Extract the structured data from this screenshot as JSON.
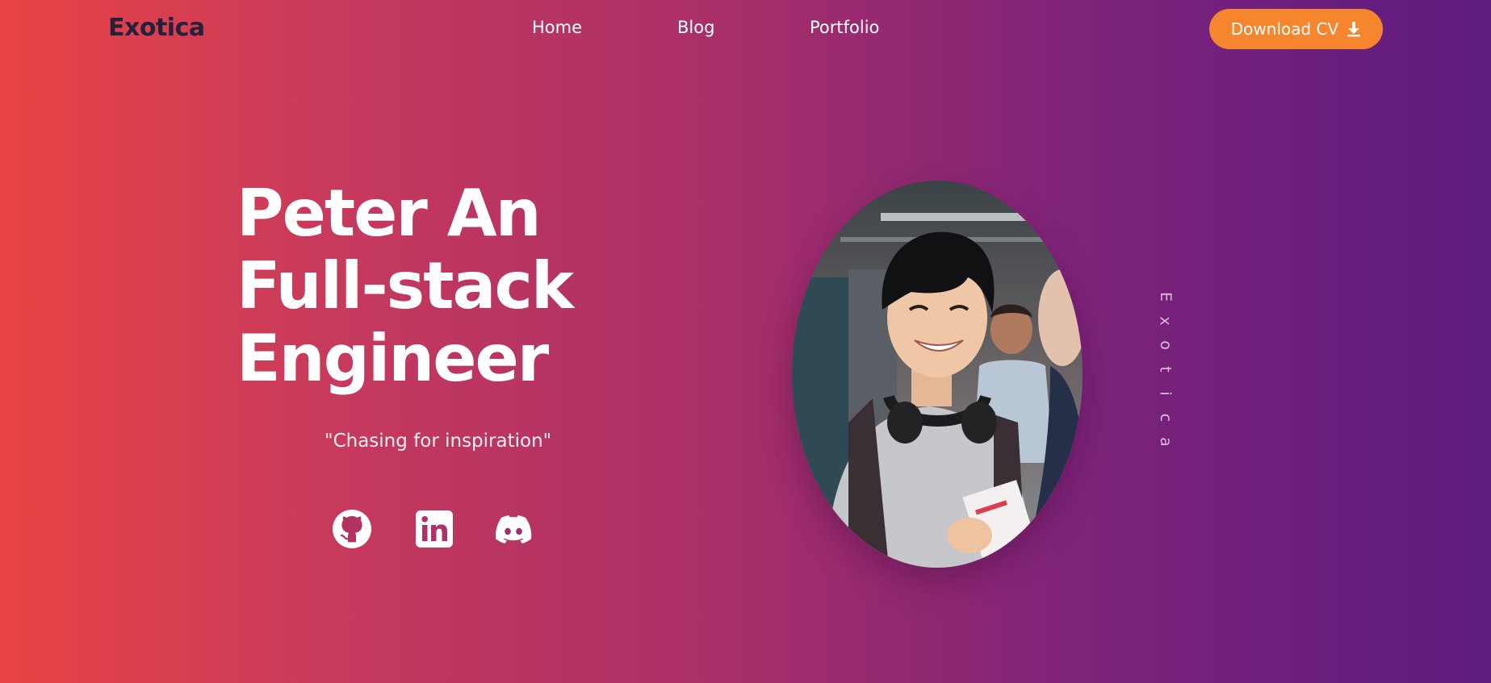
{
  "nav": {
    "brand": "Exotica",
    "links": [
      {
        "label": "Home"
      },
      {
        "label": "Blog"
      },
      {
        "label": "Portfolio"
      }
    ],
    "cta_label": "Download CV",
    "cta_icon": "download-icon",
    "cta_color": "#f6862e"
  },
  "hero": {
    "headline_lines": [
      "Peter An",
      "Full-stack",
      "Engineer"
    ],
    "tagline": "\"Chasing for inspiration\"",
    "socials": [
      {
        "icon": "github-icon"
      },
      {
        "icon": "linkedin-icon"
      },
      {
        "icon": "discord-icon"
      }
    ],
    "side_text_letters": [
      "E",
      "x",
      "o",
      "t",
      "i",
      "c",
      "a"
    ]
  },
  "colors": {
    "gradient_start": "#e94444",
    "gradient_end": "#5d1c80",
    "brand_text": "#25213a"
  }
}
